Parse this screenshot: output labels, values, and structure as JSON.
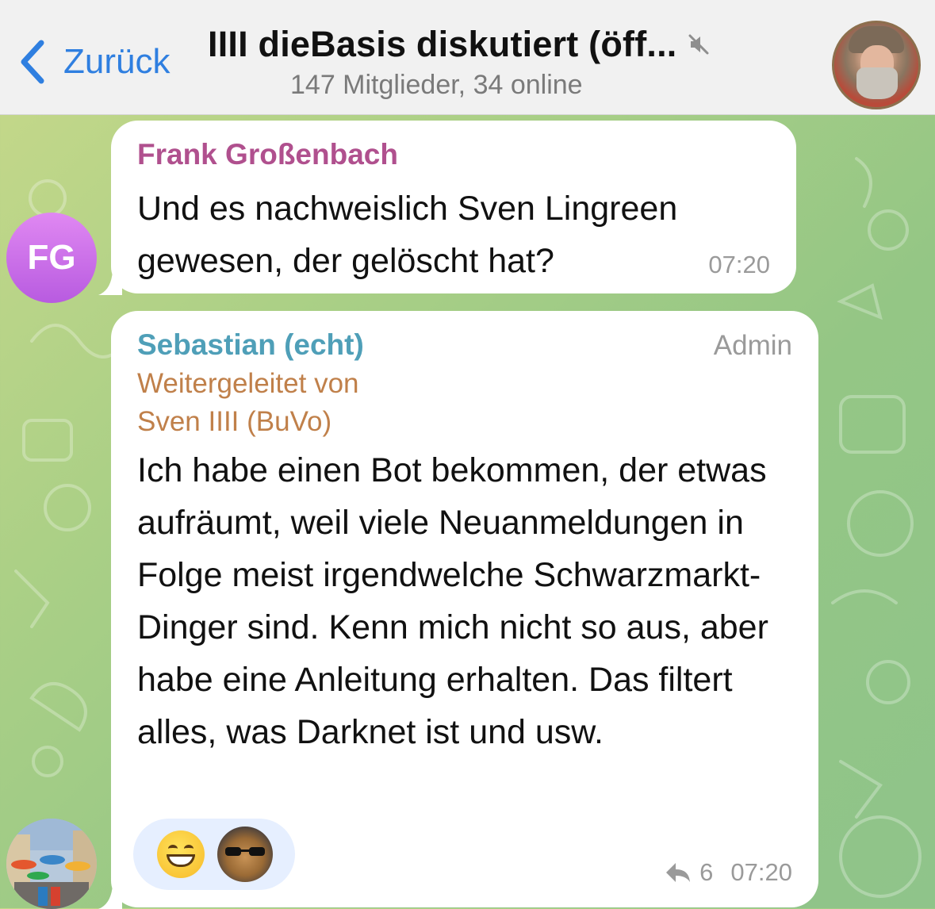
{
  "header": {
    "back_label": "Zurück",
    "title": "IIII dieBasis diskutiert (öff...",
    "subtitle": "147 Mitglieder, 34 online"
  },
  "messages": [
    {
      "avatar_initials": "FG",
      "sender": "Frank Großenbach",
      "text": "Und es nachweislich Sven Lingreen gewesen, der gelöscht hat?",
      "time": "07:20"
    },
    {
      "sender": "Sebastian (echt)",
      "role": "Admin",
      "forwarded_label": "Weitergeleitet von",
      "forwarded_from": "Sven IIII (BuVo)",
      "text": "Ich habe einen Bot bekommen, der etwas aufräumt, weil viele Neuanmeldungen in Folge meist irgendwelche Schwarzmarkt-Dinger sind. Kenn mich nicht so aus, aber habe eine Anleitung erhalten. Das filtert alles, was Darknet ist und usw.",
      "reactions": [
        "grinning-emoji",
        "dog-sunglasses-sticker"
      ],
      "reply_count": "6",
      "time": "07:20"
    }
  ],
  "icons": {
    "back": "chevron-left-icon",
    "mute": "speaker-muted-icon",
    "reply": "reply-arrow-icon"
  },
  "colors": {
    "accent": "#2f7fe0",
    "sender_frank": "#b0508e",
    "sender_sebastian": "#4f9fb8",
    "forwarded": "#c0804a",
    "avatar_fg": "#c86ce8",
    "reaction_bg": "#e6efff"
  }
}
